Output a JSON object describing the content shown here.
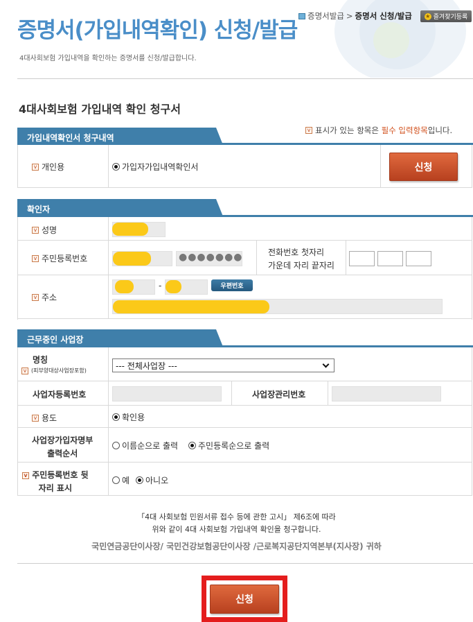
{
  "header": {
    "title": "증명서(가입내역확인) 신청/발급",
    "subtitle": "4대사회보험 가입내역을 확인하는 증명서를 신청/발급합니다.",
    "breadcrumb": [
      "증명서발급",
      "증명서 신청/발급"
    ],
    "bookmark_label": "즐겨찾기등록"
  },
  "form_title": "4대사회보험 가입내역 확인 청구서",
  "required_note": {
    "prefix": "표시가 있는 항목은 ",
    "highlight": "필수 입력항목",
    "suffix": "입니다."
  },
  "request_section": {
    "tab": "가입내역확인서 청구내역",
    "purpose_label": "개인용",
    "purpose_option": "가입자가입내역확인서",
    "apply_label": "신청"
  },
  "verifier_section": {
    "tab": "확인자",
    "name_label": "성명",
    "rrn_label": "주민등록번호",
    "rrn_mask": "●●●●●●●",
    "phone_label_line1": "전화번호 첫자리",
    "phone_label_line2": "가운데 자리 끝자리",
    "address_label": "주소",
    "zip_dash": "-",
    "zip_button": "우편번호"
  },
  "workplace_section": {
    "tab": "근무중인 사업장",
    "name_label": "명칭",
    "name_sublabel": "(피부양대상사업장포함)",
    "workplace_select": "--- 전체사업장 ---",
    "biz_reg_label": "사업자등록번호",
    "biz_mgmt_label": "사업장관리번호",
    "usage_label": "용도",
    "usage_option": "확인용",
    "order_label_line1": "사업장가입자명부",
    "order_label_line2": "출력순서",
    "order_options": [
      "이름순으로 출력",
      "주민등록순으로 출력"
    ],
    "order_selected": 1,
    "rrn_show_label_line1": "주민등록번호 뒷",
    "rrn_show_label_line2": "자리 표시",
    "rrn_show_options": [
      "예",
      "아니오"
    ],
    "rrn_show_selected": 1
  },
  "notice": {
    "line1": "「4대 사회보험 민원서류 접수 등에 관한 고시」 제6조에 따라",
    "line2": "위와 같이 4대 사회보험 가입내역 확인을 청구합니다.",
    "orgs": "국민연금공단이사장/ 국민건강보험공단이사장 /근로복지공단지역본부(지사장) 귀하"
  },
  "submit_label": "신청",
  "colors": {
    "accent": "#4a8ec8",
    "tab": "#3f7faa",
    "button": "#c9512a",
    "highlight": "#e41d1d",
    "mask": "#fbc919"
  }
}
